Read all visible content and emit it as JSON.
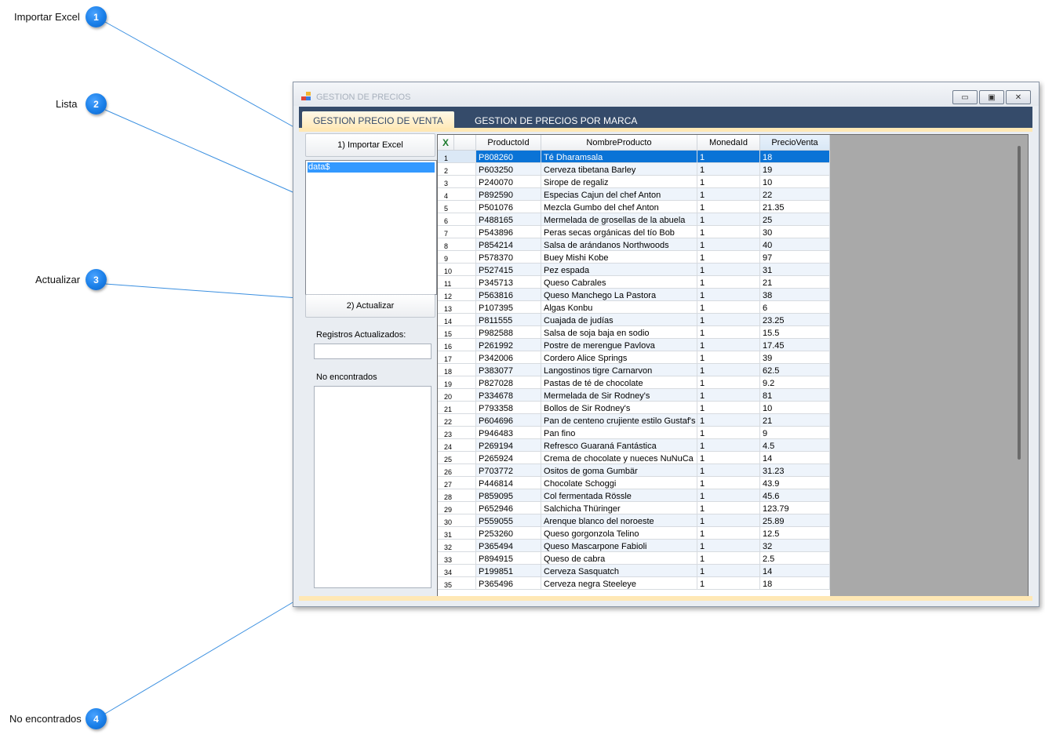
{
  "callouts": [
    {
      "label": "Importar Excel",
      "number": "1"
    },
    {
      "label": "Lista",
      "number": "2"
    },
    {
      "label": "Actualizar",
      "number": "3"
    },
    {
      "label": "No encontrados",
      "number": "4"
    }
  ],
  "window": {
    "title": "GESTION DE PRECIOS",
    "controls": {
      "minimize": "▭",
      "maximize": "▣",
      "close": "✕"
    }
  },
  "tabs": [
    {
      "label": "GESTION PRECIO DE VENTA",
      "active": true
    },
    {
      "label": "GESTION DE PRECIOS POR MARCA",
      "active": false
    }
  ],
  "left_panel": {
    "import_button": "1) Importar Excel",
    "list_items": [
      "data$"
    ],
    "update_button": "2) Actualizar",
    "registros_label": "Registros Actualizados:",
    "registros_value": "",
    "no_encontrados_label": "No encontrados",
    "no_encontrados_value": ""
  },
  "grid": {
    "corner_icon": "X",
    "columns": [
      "ProductoId",
      "NombreProducto",
      "MonedaId",
      "PrecioVenta"
    ],
    "rows": [
      [
        "1",
        "P808260",
        "Té Dharamsala",
        "1",
        "18"
      ],
      [
        "2",
        "P603250",
        "Cerveza tibetana Barley",
        "1",
        "19"
      ],
      [
        "3",
        "P240070",
        "Sirope de regaliz",
        "1",
        "10"
      ],
      [
        "4",
        "P892590",
        "Especias Cajun del chef Anton",
        "1",
        "22"
      ],
      [
        "5",
        "P501076",
        "Mezcla Gumbo del chef Anton",
        "1",
        "21.35"
      ],
      [
        "6",
        "P488165",
        "Mermelada de grosellas de la abuela",
        "1",
        "25"
      ],
      [
        "7",
        "P543896",
        "Peras secas orgánicas del tío Bob",
        "1",
        "30"
      ],
      [
        "8",
        "P854214",
        "Salsa de arándanos Northwoods",
        "1",
        "40"
      ],
      [
        "9",
        "P578370",
        "Buey Mishi Kobe",
        "1",
        "97"
      ],
      [
        "10",
        "P527415",
        "Pez espada",
        "1",
        "31"
      ],
      [
        "11",
        "P345713",
        "Queso Cabrales",
        "1",
        "21"
      ],
      [
        "12",
        "P563816",
        "Queso Manchego La Pastora",
        "1",
        "38"
      ],
      [
        "13",
        "P107395",
        "Algas Konbu",
        "1",
        "6"
      ],
      [
        "14",
        "P811555",
        "Cuajada de judías",
        "1",
        "23.25"
      ],
      [
        "15",
        "P982588",
        "Salsa de soja baja en sodio",
        "1",
        "15.5"
      ],
      [
        "16",
        "P261992",
        "Postre de merengue Pavlova",
        "1",
        "17.45"
      ],
      [
        "17",
        "P342006",
        "Cordero Alice Springs",
        "1",
        "39"
      ],
      [
        "18",
        "P383077",
        "Langostinos tigre Carnarvon",
        "1",
        "62.5"
      ],
      [
        "19",
        "P827028",
        "Pastas de té de chocolate",
        "1",
        "9.2"
      ],
      [
        "20",
        "P334678",
        "Mermelada de Sir Rodney's",
        "1",
        "81"
      ],
      [
        "21",
        "P793358",
        "Bollos de Sir Rodney's",
        "1",
        "10"
      ],
      [
        "22",
        "P604696",
        "Pan de centeno crujiente estilo Gustaf's",
        "1",
        "21"
      ],
      [
        "23",
        "P946483",
        "Pan fino",
        "1",
        "9"
      ],
      [
        "24",
        "P269194",
        "Refresco Guaraná Fantástica",
        "1",
        "4.5"
      ],
      [
        "25",
        "P265924",
        "Crema de chocolate y nueces NuNuCa",
        "1",
        "14"
      ],
      [
        "26",
        "P703772",
        "Ositos de goma Gumbär",
        "1",
        "31.23"
      ],
      [
        "27",
        "P446814",
        "Chocolate Schoggi",
        "1",
        "43.9"
      ],
      [
        "28",
        "P859095",
        "Col fermentada Rössle",
        "1",
        "45.6"
      ],
      [
        "29",
        "P652946",
        "Salchicha Thüringer",
        "1",
        "123.79"
      ],
      [
        "30",
        "P559055",
        "Arenque blanco del noroeste",
        "1",
        "25.89"
      ],
      [
        "31",
        "P253260",
        "Queso gorgonzola Telino",
        "1",
        "12.5"
      ],
      [
        "32",
        "P365494",
        "Queso Mascarpone Fabioli",
        "1",
        "32"
      ],
      [
        "33",
        "P894915",
        "Queso de cabra",
        "1",
        "2.5"
      ],
      [
        "34",
        "P199851",
        "Cerveza Sasquatch",
        "1",
        "14"
      ],
      [
        "35",
        "P365496",
        "Cerveza negra Steeleye",
        "1",
        "18"
      ]
    ]
  }
}
